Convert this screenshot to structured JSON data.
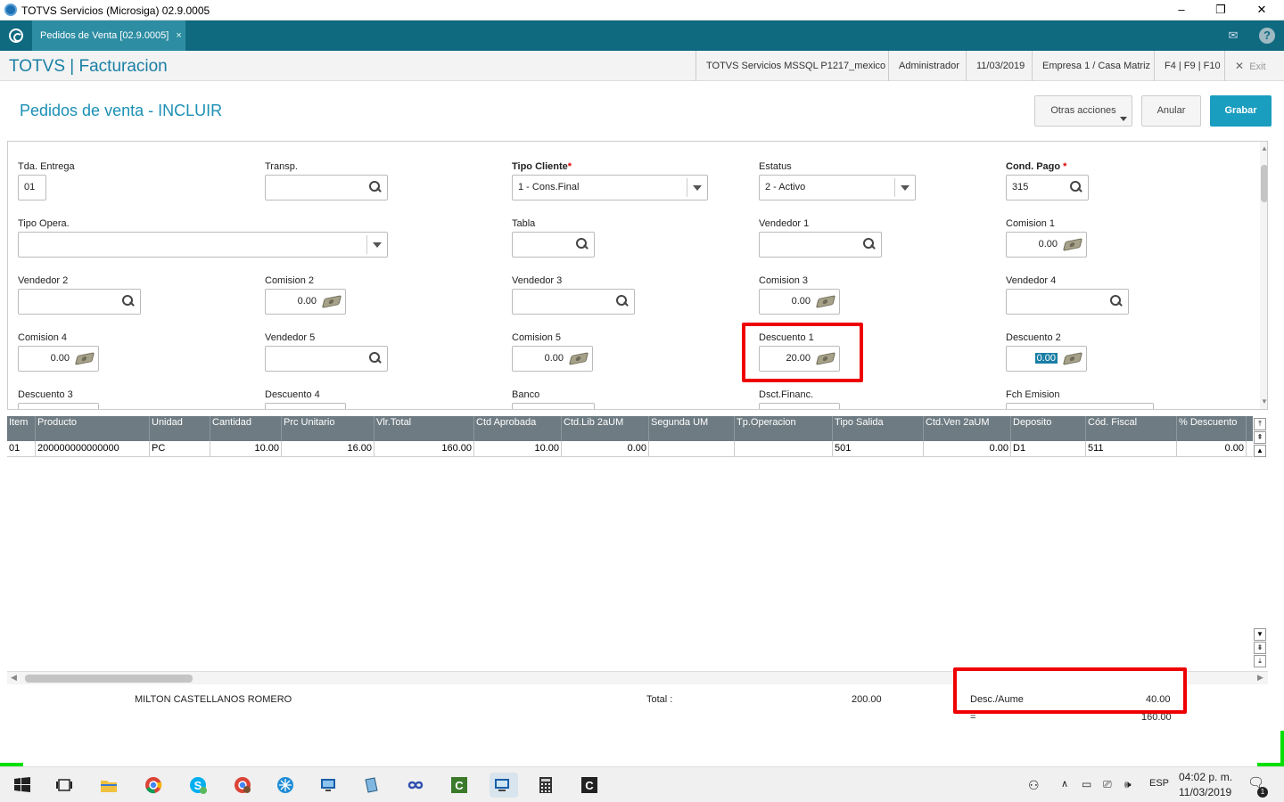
{
  "window": {
    "title": "TOTVS Servicios (Microsiga) 02.9.0005",
    "min": "–",
    "restore": "❐",
    "close": "✕"
  },
  "tabbar": {
    "tab_label": "Pedidos de Venta [02.9.0005]",
    "tab_close": "×",
    "mail_icon": "✉",
    "help_icon": "?"
  },
  "header": {
    "app_title": "TOTVS | Facturacion",
    "items": [
      "TOTVS Servicios MSSQL P1217_mexico",
      "Administrador",
      "11/03/2019",
      "Empresa 1 / Casa Matriz",
      "F4 | F9 | F10"
    ],
    "exit_icon": "✕",
    "exit_label": "Exit"
  },
  "page": {
    "title": "Pedidos de venta - INCLUIR",
    "btn_otras": "Otras acciones",
    "btn_anular": "Anular",
    "btn_grabar": "Grabar"
  },
  "form": {
    "tda_entrega": {
      "label": "Tda. Entrega",
      "value": "01"
    },
    "transp": {
      "label": "Transp.",
      "value": ""
    },
    "tipo_cliente": {
      "label": "Tipo Cliente",
      "req": "*",
      "value": "1 - Cons.Final"
    },
    "estatus": {
      "label": "Estatus",
      "value": "2 - Activo"
    },
    "cond_pago": {
      "label": "Cond. Pago",
      "req": "*",
      "value": "315"
    },
    "tipo_opera": {
      "label": "Tipo Opera.",
      "value": ""
    },
    "tabla": {
      "label": "Tabla",
      "value": ""
    },
    "vendedor1": {
      "label": "Vendedor 1",
      "value": ""
    },
    "comision1": {
      "label": "Comision 1",
      "value": "0.00"
    },
    "vendedor2": {
      "label": "Vendedor 2",
      "value": ""
    },
    "comision2": {
      "label": "Comision 2",
      "value": "0.00"
    },
    "vendedor3": {
      "label": "Vendedor 3",
      "value": ""
    },
    "comision3": {
      "label": "Comision 3",
      "value": "0.00"
    },
    "vendedor4": {
      "label": "Vendedor 4",
      "value": ""
    },
    "comision4": {
      "label": "Comision 4",
      "value": "0.00"
    },
    "vendedor5": {
      "label": "Vendedor 5",
      "value": ""
    },
    "comision5": {
      "label": "Comision 5",
      "value": "0.00"
    },
    "descuento1": {
      "label": "Descuento 1",
      "value": "20.00"
    },
    "descuento2": {
      "label": "Descuento 2",
      "value": "0.00"
    },
    "descuento3": {
      "label": "Descuento 3"
    },
    "descuento4": {
      "label": "Descuento 4"
    },
    "banco": {
      "label": "Banco"
    },
    "dsct_financ": {
      "label": "Dsct.Financ."
    },
    "fch_emision": {
      "label": "Fch Emision"
    }
  },
  "grid": {
    "columns": [
      "Item",
      "Producto",
      "Unidad",
      "Cantidad",
      "Prc Unitario",
      "Vlr.Total",
      "Ctd Aprobada",
      "Ctd.Lib 2aUM",
      "Segunda UM",
      "Tp.Operacion",
      "Tipo Salida",
      "Ctd.Ven 2aUM",
      "Deposito",
      "Cód. Fiscal",
      "% Descuento"
    ],
    "rows": [
      [
        "01",
        "200000000000000",
        "PC",
        "10.00",
        "16.00",
        "160.00",
        "10.00",
        "0.00",
        "",
        "",
        "501",
        "0.00",
        "D1",
        "511",
        "0.00"
      ]
    ]
  },
  "footer": {
    "customer": "MILTON CASTELLANOS ROMERO",
    "total_label": "Total :",
    "total_value": "200.00",
    "desc_label": "Desc./Aume",
    "desc_value": "40.00",
    "eq_label": "=",
    "eq_value": "160.00"
  },
  "taskbar": {
    "lang": "ESP",
    "time": "04:02 p. m.",
    "date": "11/03/2019",
    "notif_count": "1"
  },
  "colors": {
    "accent": "#0f6a80",
    "primary_button": "#1a9ec0",
    "highlight_box": "#e00000"
  }
}
